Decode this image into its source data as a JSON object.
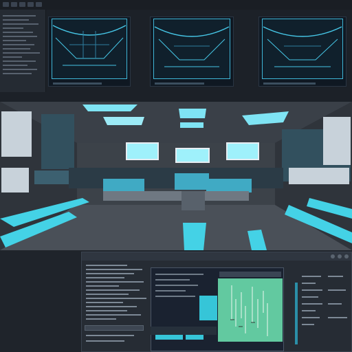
{
  "top_panel": {
    "status_text": "",
    "thumbnails": [
      "",
      "",
      ""
    ]
  },
  "editor": {
    "title": "",
    "graph_header": "",
    "footer_label": ""
  },
  "colors": {
    "accent": "#36c5d8",
    "background": "#1c2128",
    "graph": "#62c9a0"
  }
}
